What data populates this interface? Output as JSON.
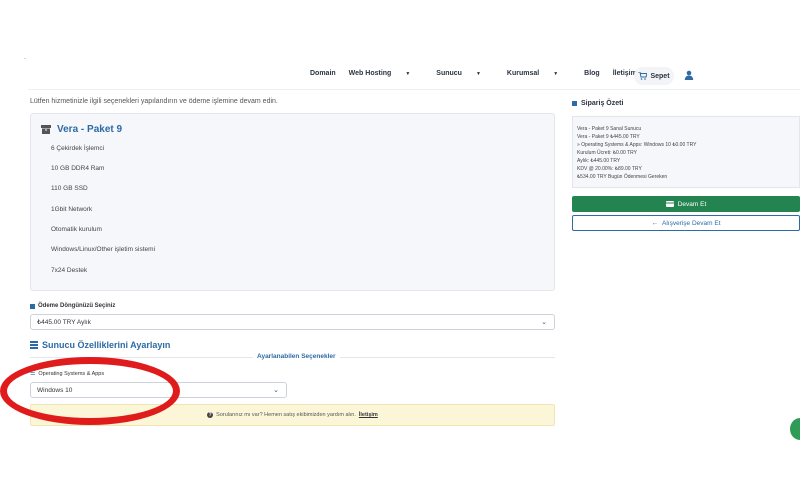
{
  "nav": {
    "items": [
      "Domain",
      "Web Hosting",
      "Sunucu",
      "Kurumsal",
      "Blog",
      "İletişim"
    ],
    "cart_label": "Sepet"
  },
  "intro": "Lütfen hizmetinizle ilgili seçenekleri yapılandırın ve ödeme işlemine devam edin.",
  "package": {
    "title": "Vera - Paket 9",
    "features": [
      "6 Çekirdek İşlemci",
      "10 GB DDR4 Ram",
      "110 GB SSD",
      "1Gbit Network",
      "Otomatik kurulum",
      "Windows/Linux/Other işletim sistemi",
      "7x24 Destek"
    ]
  },
  "billing": {
    "label": "Ödeme Döngünüzü Seçiniz",
    "selected": "₺445.00 TRY Aylık"
  },
  "config": {
    "title": "Sunucu Özelliklerini Ayarlayın",
    "subtitle": "Ayarlanabilen Seçenekler",
    "os_label": "Operating Systems & Apps",
    "os_selected": "Windows 10"
  },
  "help": {
    "text": "Sorularınız mı var? Hemen satış ekibimizden yardım alın.",
    "link": "İletişim"
  },
  "summary": {
    "title": "Sipariş Özeti",
    "lines": [
      "Vera - Paket 9 Sanal Sunucu",
      "Vera - Paket 9 ₺445.00 TRY",
      "» Operating Systems & Apps: Windows 10 ₺0.00 TRY",
      "Kurulum Ücreti: ₺0.00 TRY",
      "Aylık: ₺445.00 TRY",
      "KDV @ 20.00%: ₺89.00 TRY",
      "₺534.00 TRY Bugün Ödenmesi Gereken"
    ],
    "continue_label": "Devam Et",
    "shopping_label": "Alışverişe Devam Et"
  },
  "colors": {
    "accent": "#2d6aa6",
    "success": "#238450",
    "highlight": "#e01b1b"
  }
}
